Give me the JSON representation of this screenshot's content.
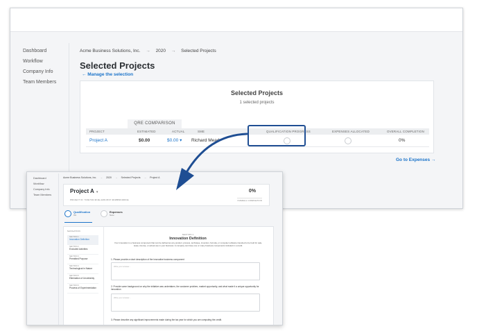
{
  "back": {
    "sidebar": [
      "Dashboard",
      "Workflow",
      "Company Info",
      "Team Members"
    ],
    "breadcrumbs": [
      "Acme Business Solutions, Inc.",
      "2020",
      "Selected Projects"
    ],
    "breadcrumb_sep": "→",
    "page_title": "Selected Projects",
    "manage_link": "← Manage the selection",
    "panel_title": "Selected Projects",
    "panel_subtitle": "1 selected projects",
    "qre_header": "QRE COMPARISON",
    "columns": {
      "project": "PROJECT",
      "estimated": "ESTIMATED",
      "actual": "ACTUAL",
      "sme": "SME",
      "qual": "QUALIFICATION PROGRESS",
      "expenses": "EXPENSES ALLOCATED",
      "overall": "OVERALL COMPLETION"
    },
    "row": {
      "project": "Project A",
      "estimated": "$0.00",
      "actual": "$0.00 ▾",
      "sme": "Richard Mead",
      "overall": "0%"
    },
    "goto_link": "Go to Expenses →"
  },
  "front": {
    "sidebar": [
      "Dashboard",
      "Workflow",
      "Company Info",
      "Team Members"
    ],
    "breadcrumbs": [
      "Acme Business Solutions, Inc.",
      "2020",
      "Selected Projects",
      "Project A"
    ],
    "breadcrumb_sep": "→",
    "project_title": "Project A",
    "project_dropdown": "▾",
    "project_subtitle": "PROJECT ID: 7C6E7CD-9F4E-4206-8F07-9D1BB3F4DDCE",
    "completion_pct": "0%",
    "completion_label": "OVERALL COMPLETION",
    "steps": [
      {
        "label": "Qualification",
        "sub": "0%"
      },
      {
        "label": "Expenses",
        "sub": "None"
      }
    ],
    "nav_header": "NAVIGATION",
    "nav": [
      {
        "sec": "SECTION 1",
        "label": "Innovation Definition"
      },
      {
        "sec": "SECTION 2",
        "label": "Excluded Activities"
      },
      {
        "sec": "SECTION 3",
        "label": "Permitted Purpose"
      },
      {
        "sec": "SECTION 4",
        "label": "Technological in Nature"
      },
      {
        "sec": "SECTION 5",
        "label": "Elimination of Uncertainty"
      },
      {
        "sec": "SECTION 6",
        "label": "Process of Experimentation"
      }
    ],
    "section_num": "SECTION 1",
    "section_title": "Innovation Definition",
    "section_desc": "Your innovation is a business component that can be defined as any product, process, technique, invention, formula, or computer software intended to be held for sale, lease, license, or actual use in your business. A company can have one or many business components included in a credit.",
    "q1": "1. Please provide a short description of the innovative business component",
    "q2": "2. Provide some background on why the initiative was undertaken, the customer problem, market opportunity, and what made it a unique opportunity for innovation",
    "q3": "3. Please describe any significant improvements made during the tax year for which you are computing the credit.",
    "placeholder": "Write your answer..."
  },
  "colors": {
    "accent": "#1a73c9",
    "highlight": "#1f4e93"
  }
}
